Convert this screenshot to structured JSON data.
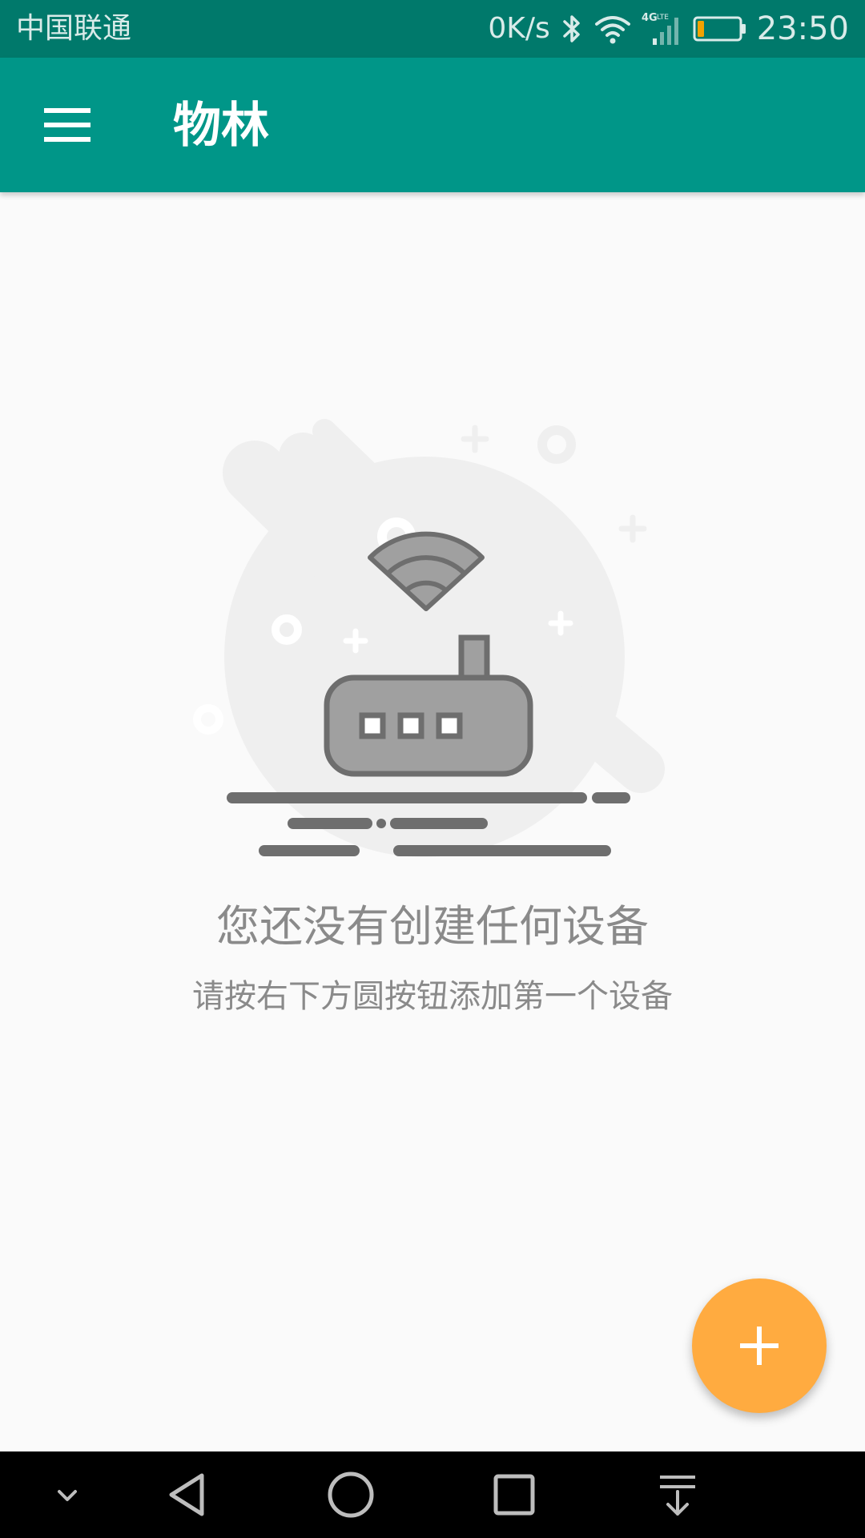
{
  "status_bar": {
    "carrier": "中国联通",
    "network_speed": "0K/s",
    "network_type": "4G",
    "network_subtype": "LTE",
    "time": "23:50",
    "icons": [
      "bluetooth-icon",
      "wifi-icon",
      "cellular-signal-icon",
      "battery-icon"
    ],
    "battery_level": 0.15
  },
  "app_bar": {
    "title": "物林",
    "menu_icon": "hamburger-menu-icon"
  },
  "empty_state": {
    "illustration": "wifi-router-icon",
    "title": "您还没有创建任何设备",
    "subtitle": "请按右下方圆按钮添加第一个设备"
  },
  "fab": {
    "icon": "plus-icon"
  },
  "nav_bar": {
    "items": [
      "collapse-icon",
      "back-icon",
      "home-icon",
      "recents-icon",
      "notification-pull-icon"
    ]
  },
  "colors": {
    "status_bar": "#00796b",
    "app_bar": "#009688",
    "background": "#fafafa",
    "fab": "#ffab40",
    "empty_text": "#8a8a8a",
    "nav_bar": "#000000"
  }
}
